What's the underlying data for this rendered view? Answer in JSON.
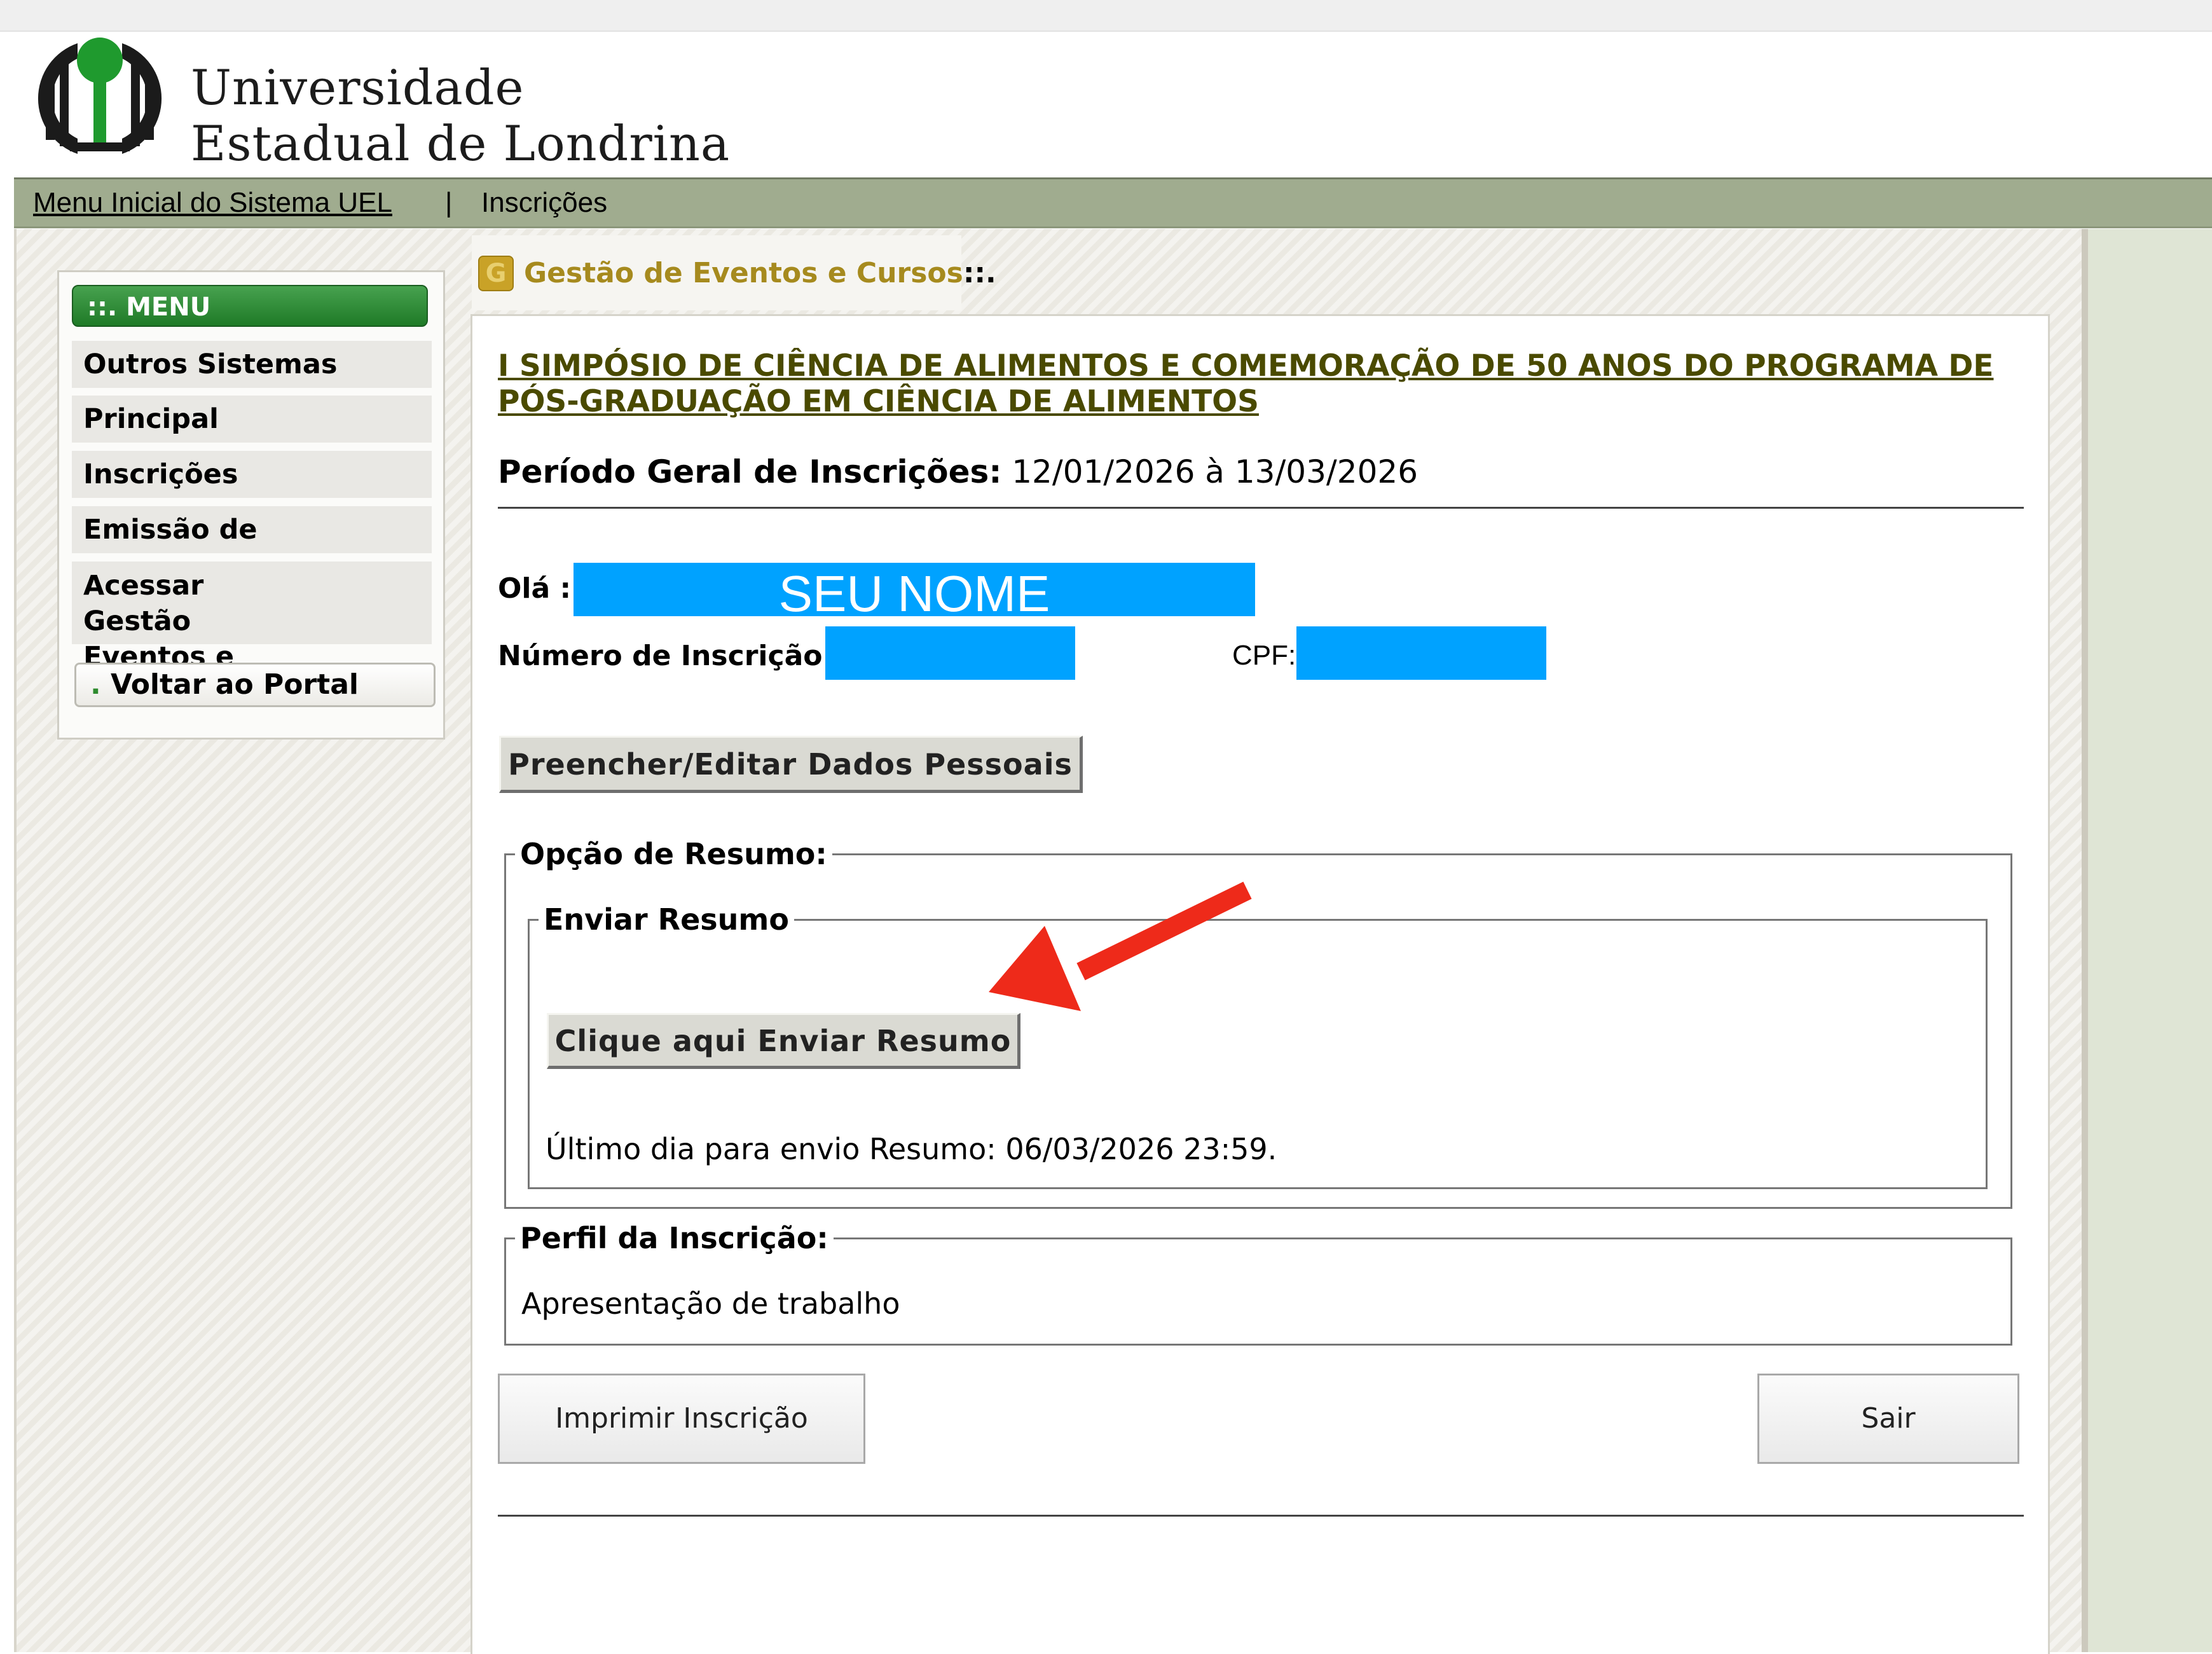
{
  "header": {
    "university_line1": "Universidade",
    "university_line2": "Estadual de Londrina"
  },
  "navbar": {
    "home_link": "Menu Inicial do Sistema UEL",
    "separator": "|",
    "current": "Inscrições"
  },
  "sidebar": {
    "header": "::. MENU",
    "items": [
      {
        "label": "Outros Sistemas"
      },
      {
        "label": "Principal"
      },
      {
        "label": "Inscrições"
      },
      {
        "label": "Emissão de Certificados"
      },
      {
        "label": "Acessar Gestão Eventos e Cursos"
      }
    ],
    "back_dot": ".",
    "back_label": "Voltar ao Portal"
  },
  "breadcrumb": {
    "icon_letter": "G",
    "title": "Gestão de Eventos e Cursos",
    "suffix": "::."
  },
  "event": {
    "title": "I SIMPÓSIO DE CIÊNCIA DE ALIMENTOS E COMEMORAÇÃO DE 50 ANOS DO PROGRAMA DE PÓS-GRADUAÇÃO EM CIÊNCIA DE ALIMENTOS",
    "periodo_label": "Período Geral de Inscrições:",
    "periodo_value": "12/01/2026 à 13/03/2026"
  },
  "user": {
    "ola_label": "Olá :",
    "name_redacted": "SEU NOME",
    "inscricao_label": "Número de Inscrição :",
    "cpf_label": "CPF:"
  },
  "buttons": {
    "dados_pessoais": "Preencher/Editar Dados Pessoais",
    "enviar_resumo": "Clique aqui Enviar Resumo",
    "imprimir": "Imprimir Inscrição",
    "sair": "Sair"
  },
  "resumo": {
    "opcao_legend": "Opção de Resumo:",
    "enviar_legend": "Enviar Resumo",
    "ultimo_dia": "Último dia para envio Resumo: 06/03/2026 23:59."
  },
  "perfil": {
    "legend": "Perfil da Inscrição:",
    "value": "Apresentação de trabalho"
  },
  "colors": {
    "redaction": "#00a2ff",
    "arrow": "#ee2a1a",
    "menu_green": "#2e8b34",
    "navbar": "#a0ac8f",
    "title_olive": "#4a4a00",
    "crumb_gold": "#a68a1e"
  }
}
